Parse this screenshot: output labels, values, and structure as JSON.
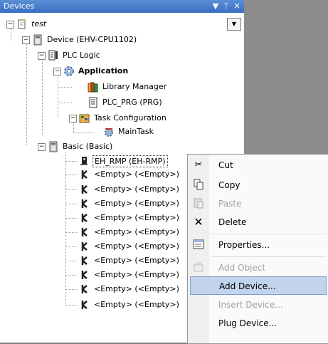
{
  "panel": {
    "title": "Devices",
    "dropdown_glyph": "▼",
    "pin_glyph": "ᛘ",
    "close_glyph": "✕"
  },
  "tree": {
    "project": "test",
    "device": "Device (EHV-CPU1102)",
    "plc_logic": "PLC Logic",
    "application": "Application",
    "library_manager": "Library Manager",
    "plc_prg": "PLC_PRG (PRG)",
    "task_configuration": "Task Configuration",
    "main_task": "MainTask",
    "basic": "Basic (Basic)",
    "eh_rmp": "EH_RMP (EH-RMP)",
    "empty_slot": "<Empty> (<Empty>)"
  },
  "context_menu": {
    "cut": "Cut",
    "copy": "Copy",
    "paste": "Paste",
    "delete": "Delete",
    "properties": "Properties...",
    "add_object": "Add Object",
    "add_device": "Add Device...",
    "insert_device": "Insert Device...",
    "plug_device": "Plug Device..."
  },
  "colors": {
    "title_bar": "#3a6fc3",
    "menu_highlight": "#c2d3ec",
    "disabled_text": "#a0a0a0"
  }
}
